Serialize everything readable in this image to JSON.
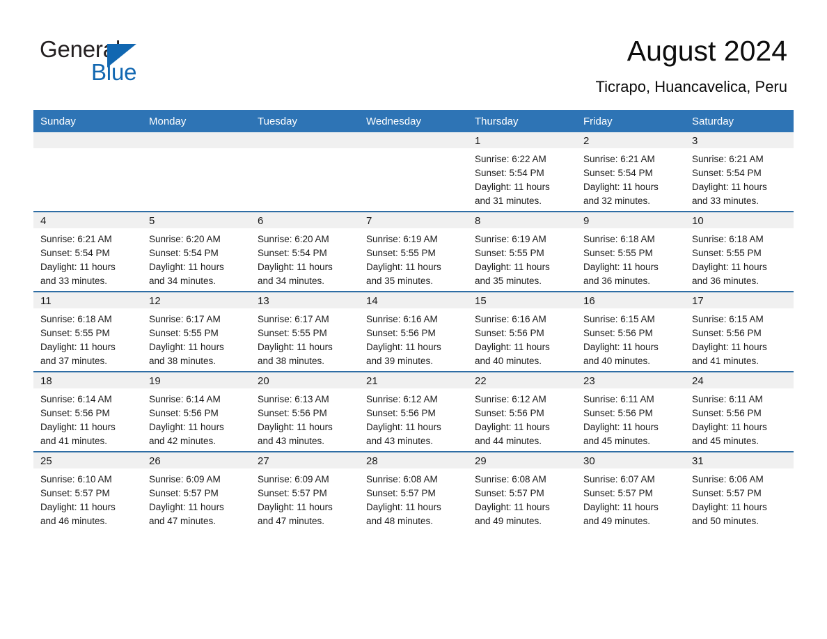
{
  "brand": {
    "name_part1": "General",
    "name_part2": "Blue",
    "primary_color": "#1167b1"
  },
  "header": {
    "month_title": "August 2024",
    "location": "Ticrapo, Huancavelica, Peru"
  },
  "calendar": {
    "header_color": "#2e74b5",
    "separator_color": "#2e6da4",
    "daynum_bg": "#f0f0f0",
    "weekdays": [
      "Sunday",
      "Monday",
      "Tuesday",
      "Wednesday",
      "Thursday",
      "Friday",
      "Saturday"
    ],
    "weeks": [
      [
        {
          "day": "",
          "sunrise": "",
          "sunset": "",
          "daylight_line1": "",
          "daylight_line2": ""
        },
        {
          "day": "",
          "sunrise": "",
          "sunset": "",
          "daylight_line1": "",
          "daylight_line2": ""
        },
        {
          "day": "",
          "sunrise": "",
          "sunset": "",
          "daylight_line1": "",
          "daylight_line2": ""
        },
        {
          "day": "",
          "sunrise": "",
          "sunset": "",
          "daylight_line1": "",
          "daylight_line2": ""
        },
        {
          "day": "1",
          "sunrise": "Sunrise: 6:22 AM",
          "sunset": "Sunset: 5:54 PM",
          "daylight_line1": "Daylight: 11 hours",
          "daylight_line2": "and 31 minutes."
        },
        {
          "day": "2",
          "sunrise": "Sunrise: 6:21 AM",
          "sunset": "Sunset: 5:54 PM",
          "daylight_line1": "Daylight: 11 hours",
          "daylight_line2": "and 32 minutes."
        },
        {
          "day": "3",
          "sunrise": "Sunrise: 6:21 AM",
          "sunset": "Sunset: 5:54 PM",
          "daylight_line1": "Daylight: 11 hours",
          "daylight_line2": "and 33 minutes."
        }
      ],
      [
        {
          "day": "4",
          "sunrise": "Sunrise: 6:21 AM",
          "sunset": "Sunset: 5:54 PM",
          "daylight_line1": "Daylight: 11 hours",
          "daylight_line2": "and 33 minutes."
        },
        {
          "day": "5",
          "sunrise": "Sunrise: 6:20 AM",
          "sunset": "Sunset: 5:54 PM",
          "daylight_line1": "Daylight: 11 hours",
          "daylight_line2": "and 34 minutes."
        },
        {
          "day": "6",
          "sunrise": "Sunrise: 6:20 AM",
          "sunset": "Sunset: 5:54 PM",
          "daylight_line1": "Daylight: 11 hours",
          "daylight_line2": "and 34 minutes."
        },
        {
          "day": "7",
          "sunrise": "Sunrise: 6:19 AM",
          "sunset": "Sunset: 5:55 PM",
          "daylight_line1": "Daylight: 11 hours",
          "daylight_line2": "and 35 minutes."
        },
        {
          "day": "8",
          "sunrise": "Sunrise: 6:19 AM",
          "sunset": "Sunset: 5:55 PM",
          "daylight_line1": "Daylight: 11 hours",
          "daylight_line2": "and 35 minutes."
        },
        {
          "day": "9",
          "sunrise": "Sunrise: 6:18 AM",
          "sunset": "Sunset: 5:55 PM",
          "daylight_line1": "Daylight: 11 hours",
          "daylight_line2": "and 36 minutes."
        },
        {
          "day": "10",
          "sunrise": "Sunrise: 6:18 AM",
          "sunset": "Sunset: 5:55 PM",
          "daylight_line1": "Daylight: 11 hours",
          "daylight_line2": "and 36 minutes."
        }
      ],
      [
        {
          "day": "11",
          "sunrise": "Sunrise: 6:18 AM",
          "sunset": "Sunset: 5:55 PM",
          "daylight_line1": "Daylight: 11 hours",
          "daylight_line2": "and 37 minutes."
        },
        {
          "day": "12",
          "sunrise": "Sunrise: 6:17 AM",
          "sunset": "Sunset: 5:55 PM",
          "daylight_line1": "Daylight: 11 hours",
          "daylight_line2": "and 38 minutes."
        },
        {
          "day": "13",
          "sunrise": "Sunrise: 6:17 AM",
          "sunset": "Sunset: 5:55 PM",
          "daylight_line1": "Daylight: 11 hours",
          "daylight_line2": "and 38 minutes."
        },
        {
          "day": "14",
          "sunrise": "Sunrise: 6:16 AM",
          "sunset": "Sunset: 5:56 PM",
          "daylight_line1": "Daylight: 11 hours",
          "daylight_line2": "and 39 minutes."
        },
        {
          "day": "15",
          "sunrise": "Sunrise: 6:16 AM",
          "sunset": "Sunset: 5:56 PM",
          "daylight_line1": "Daylight: 11 hours",
          "daylight_line2": "and 40 minutes."
        },
        {
          "day": "16",
          "sunrise": "Sunrise: 6:15 AM",
          "sunset": "Sunset: 5:56 PM",
          "daylight_line1": "Daylight: 11 hours",
          "daylight_line2": "and 40 minutes."
        },
        {
          "day": "17",
          "sunrise": "Sunrise: 6:15 AM",
          "sunset": "Sunset: 5:56 PM",
          "daylight_line1": "Daylight: 11 hours",
          "daylight_line2": "and 41 minutes."
        }
      ],
      [
        {
          "day": "18",
          "sunrise": "Sunrise: 6:14 AM",
          "sunset": "Sunset: 5:56 PM",
          "daylight_line1": "Daylight: 11 hours",
          "daylight_line2": "and 41 minutes."
        },
        {
          "day": "19",
          "sunrise": "Sunrise: 6:14 AM",
          "sunset": "Sunset: 5:56 PM",
          "daylight_line1": "Daylight: 11 hours",
          "daylight_line2": "and 42 minutes."
        },
        {
          "day": "20",
          "sunrise": "Sunrise: 6:13 AM",
          "sunset": "Sunset: 5:56 PM",
          "daylight_line1": "Daylight: 11 hours",
          "daylight_line2": "and 43 minutes."
        },
        {
          "day": "21",
          "sunrise": "Sunrise: 6:12 AM",
          "sunset": "Sunset: 5:56 PM",
          "daylight_line1": "Daylight: 11 hours",
          "daylight_line2": "and 43 minutes."
        },
        {
          "day": "22",
          "sunrise": "Sunrise: 6:12 AM",
          "sunset": "Sunset: 5:56 PM",
          "daylight_line1": "Daylight: 11 hours",
          "daylight_line2": "and 44 minutes."
        },
        {
          "day": "23",
          "sunrise": "Sunrise: 6:11 AM",
          "sunset": "Sunset: 5:56 PM",
          "daylight_line1": "Daylight: 11 hours",
          "daylight_line2": "and 45 minutes."
        },
        {
          "day": "24",
          "sunrise": "Sunrise: 6:11 AM",
          "sunset": "Sunset: 5:56 PM",
          "daylight_line1": "Daylight: 11 hours",
          "daylight_line2": "and 45 minutes."
        }
      ],
      [
        {
          "day": "25",
          "sunrise": "Sunrise: 6:10 AM",
          "sunset": "Sunset: 5:57 PM",
          "daylight_line1": "Daylight: 11 hours",
          "daylight_line2": "and 46 minutes."
        },
        {
          "day": "26",
          "sunrise": "Sunrise: 6:09 AM",
          "sunset": "Sunset: 5:57 PM",
          "daylight_line1": "Daylight: 11 hours",
          "daylight_line2": "and 47 minutes."
        },
        {
          "day": "27",
          "sunrise": "Sunrise: 6:09 AM",
          "sunset": "Sunset: 5:57 PM",
          "daylight_line1": "Daylight: 11 hours",
          "daylight_line2": "and 47 minutes."
        },
        {
          "day": "28",
          "sunrise": "Sunrise: 6:08 AM",
          "sunset": "Sunset: 5:57 PM",
          "daylight_line1": "Daylight: 11 hours",
          "daylight_line2": "and 48 minutes."
        },
        {
          "day": "29",
          "sunrise": "Sunrise: 6:08 AM",
          "sunset": "Sunset: 5:57 PM",
          "daylight_line1": "Daylight: 11 hours",
          "daylight_line2": "and 49 minutes."
        },
        {
          "day": "30",
          "sunrise": "Sunrise: 6:07 AM",
          "sunset": "Sunset: 5:57 PM",
          "daylight_line1": "Daylight: 11 hours",
          "daylight_line2": "and 49 minutes."
        },
        {
          "day": "31",
          "sunrise": "Sunrise: 6:06 AM",
          "sunset": "Sunset: 5:57 PM",
          "daylight_line1": "Daylight: 11 hours",
          "daylight_line2": "and 50 minutes."
        }
      ]
    ]
  }
}
